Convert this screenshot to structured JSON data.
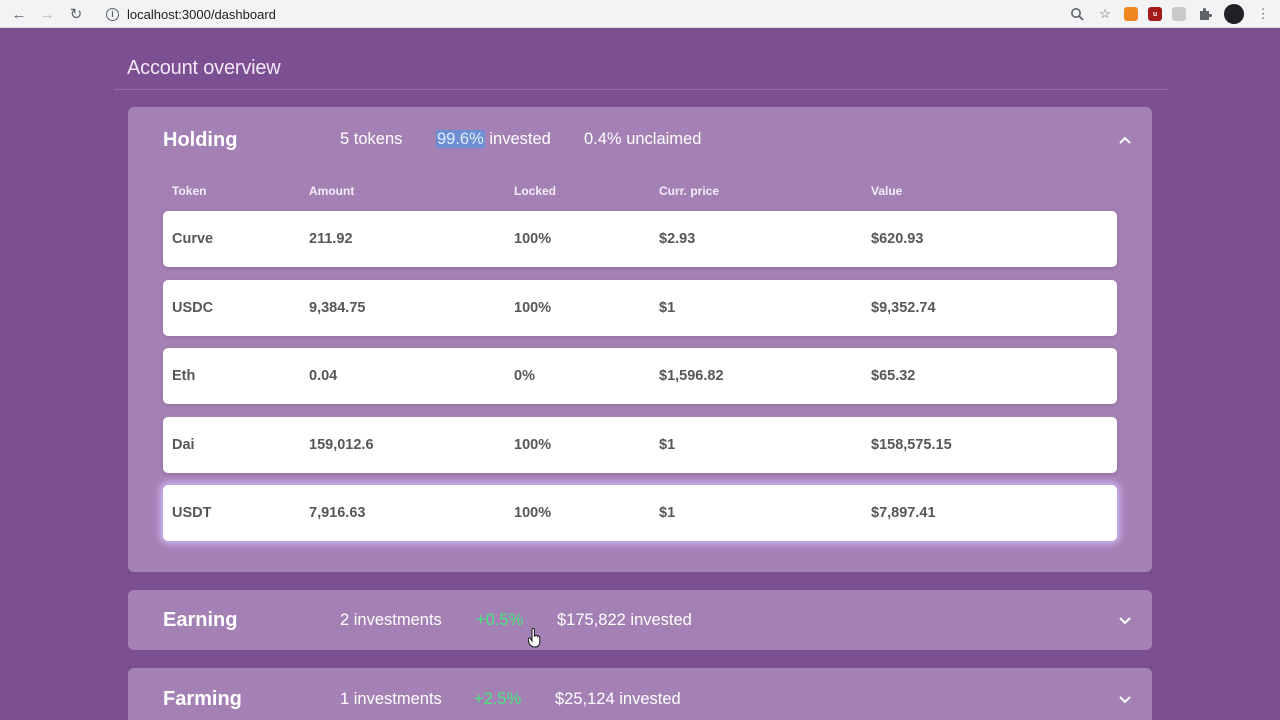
{
  "browser": {
    "url": "localhost:3000/dashboard"
  },
  "page": {
    "title": "Account overview"
  },
  "holding": {
    "name": "Holding",
    "tokens": "5 tokens",
    "invested_pct": "99.6%",
    "invested_label": " invested",
    "unclaimed": "0.4% unclaimed",
    "columns": [
      "Token",
      "Amount",
      "Locked",
      "Curr. price",
      "Value"
    ],
    "rows": [
      {
        "token": "Curve",
        "amount": "211.92",
        "locked": "100%",
        "price": "$2.93",
        "value": "$620.93"
      },
      {
        "token": "USDC",
        "amount": "9,384.75",
        "locked": "100%",
        "price": "$1",
        "value": "$9,352.74"
      },
      {
        "token": "Eth",
        "amount": "0.04",
        "locked": "0%",
        "price": "$1,596.82",
        "value": "$65.32"
      },
      {
        "token": "Dai",
        "amount": "159,012.6",
        "locked": "100%",
        "price": "$1",
        "value": "$158,575.15"
      },
      {
        "token": "USDT",
        "amount": "7,916.63",
        "locked": "100%",
        "price": "$1",
        "value": "$7,897.41"
      }
    ]
  },
  "earning": {
    "name": "Earning",
    "investments": "2 investments",
    "change": "+0.5%",
    "invested": "$175,822 invested"
  },
  "farming": {
    "name": "Farming",
    "investments": "1 investments",
    "change": "+2.5%",
    "invested": "$25,124 invested"
  },
  "colors": {
    "background": "#7b4f92",
    "panel": "#a481b5",
    "positive": "#45e87a",
    "highlight": "#6c8fd3"
  }
}
